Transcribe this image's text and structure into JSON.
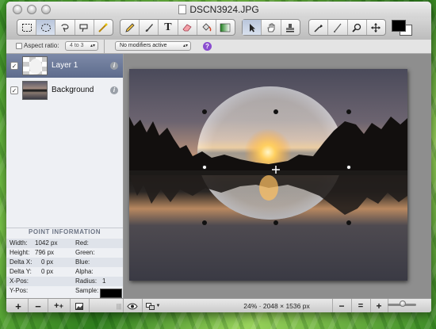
{
  "window": {
    "title": "DSCN3924.JPG"
  },
  "toolbar": {
    "selection_tools": [
      "rect-select-icon",
      "ellipse-select-icon",
      "lasso-icon",
      "magic-lasso-icon",
      "magic-wand-icon"
    ],
    "paint_tools": [
      "pencil-icon",
      "brush-icon",
      "text-icon",
      "eraser-icon",
      "paint-bucket-icon",
      "gradient-icon"
    ],
    "move_tools": [
      "arrow-icon",
      "hand-icon",
      "stamp-icon"
    ],
    "view_tools": [
      "eyedropper-icon",
      "smudge-icon",
      "zoom-icon",
      "move-icon"
    ],
    "text_tool_label": "T",
    "foreground_color": "#000000",
    "background_color": "#ffffff"
  },
  "options": {
    "aspect_ratio_label": "Aspect ratio:",
    "aspect_ratio_value": "4 to 3",
    "modifiers_value": "No modifiers active",
    "help_label": "?"
  },
  "layers": [
    {
      "name": "Layer 1",
      "selected": true,
      "visible": true
    },
    {
      "name": "Background",
      "selected": false,
      "visible": true
    }
  ],
  "point_info": {
    "header": "POINT INFORMATION",
    "rows": [
      {
        "l1": "Width:",
        "v1": "1042 px",
        "l2": "Red:",
        "v2": ""
      },
      {
        "l1": "Height:",
        "v1": "796 px",
        "l2": "Green:",
        "v2": ""
      },
      {
        "l1": "Delta X:",
        "v1": "0 px",
        "l2": "Blue:",
        "v2": ""
      },
      {
        "l1": "Delta Y:",
        "v1": "0 px",
        "l2": "Alpha:",
        "v2": ""
      },
      {
        "l1": "X-Pos:",
        "v1": "",
        "l2": "Radius:",
        "v2": "1"
      },
      {
        "l1": "Y-Pos:",
        "v1": "",
        "l2": "Sample:",
        "v2": ""
      }
    ]
  },
  "bottom": {
    "add_label": "+",
    "remove_label": "−",
    "duplicate_label": "+",
    "zoom_status": "24% · 2048 × 1536 px",
    "zoom_out_label": "−",
    "zoom_fit_label": "=",
    "zoom_in_label": "+"
  },
  "colors": {
    "selected_layer": "#6a7898",
    "help_badge": "#8a4ccf"
  }
}
